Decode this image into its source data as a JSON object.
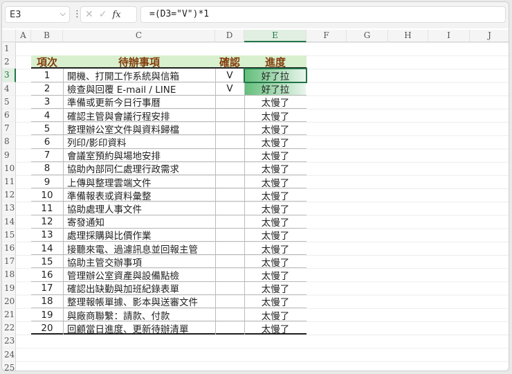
{
  "formula_bar": {
    "name_box": "E3",
    "formula": "=(D3=\"V\")*1",
    "fx_label": "fx",
    "cancel": "✕",
    "enter": "✓"
  },
  "columns": [
    "A",
    "B",
    "C",
    "D",
    "E",
    "F",
    "G",
    "H",
    "I",
    "J"
  ],
  "selected_column": "E",
  "selected_row": 3,
  "row_numbers": [
    1,
    2,
    3,
    4,
    5,
    6,
    7,
    8,
    9,
    10,
    11,
    12,
    13,
    14,
    15,
    16,
    17,
    18,
    19,
    20,
    21,
    22,
    23,
    24,
    25
  ],
  "table": {
    "headers": [
      "項次",
      "待辦事項",
      "確認",
      "進度"
    ],
    "rows": [
      [
        "1",
        "開機、打開工作系統與信箱",
        "V",
        "好了拉"
      ],
      [
        "2",
        "檢查與回覆 E-mail / LINE",
        "V",
        "好了拉"
      ],
      [
        "3",
        "準備或更新今日行事曆",
        "",
        "太慢了"
      ],
      [
        "4",
        "確認主管與會議行程安排",
        "",
        "太慢了"
      ],
      [
        "5",
        "整理辦公室文件與資料歸檔",
        "",
        "太慢了"
      ],
      [
        "6",
        "列印/影印資料",
        "",
        "太慢了"
      ],
      [
        "7",
        "會議室預約與場地安排",
        "",
        "太慢了"
      ],
      [
        "8",
        "協助內部同仁處理行政需求",
        "",
        "太慢了"
      ],
      [
        "9",
        "上傳與整理雲端文件",
        "",
        "太慢了"
      ],
      [
        "10",
        "準備報表或資料彙整",
        "",
        "太慢了"
      ],
      [
        "11",
        "協助處理人事文件",
        "",
        "太慢了"
      ],
      [
        "12",
        "寄發通知",
        "",
        "太慢了"
      ],
      [
        "13",
        "處理採購與比價作業",
        "",
        "太慢了"
      ],
      [
        "14",
        "接聽來電、過濾訊息並回報主管",
        "",
        "太慢了"
      ],
      [
        "15",
        "協助主管交辦事項",
        "",
        "太慢了"
      ],
      [
        "16",
        "管理辦公室資產與設備點檢",
        "",
        "太慢了"
      ],
      [
        "17",
        "確認出缺勤與加班紀錄表單",
        "",
        "太慢了"
      ],
      [
        "18",
        "整理報帳單據、影本與送審文件",
        "",
        "太慢了"
      ],
      [
        "19",
        "與廠商聯繫：請款、付款",
        "",
        "太慢了"
      ],
      [
        "20",
        "回顧當日進度、更新待辦清單",
        "",
        "太慢了"
      ]
    ]
  },
  "colors": {
    "header_bg": "#d9f0cf",
    "header_text": "#833c0b",
    "done_fill": "#63be7b",
    "accent": "#217346"
  }
}
